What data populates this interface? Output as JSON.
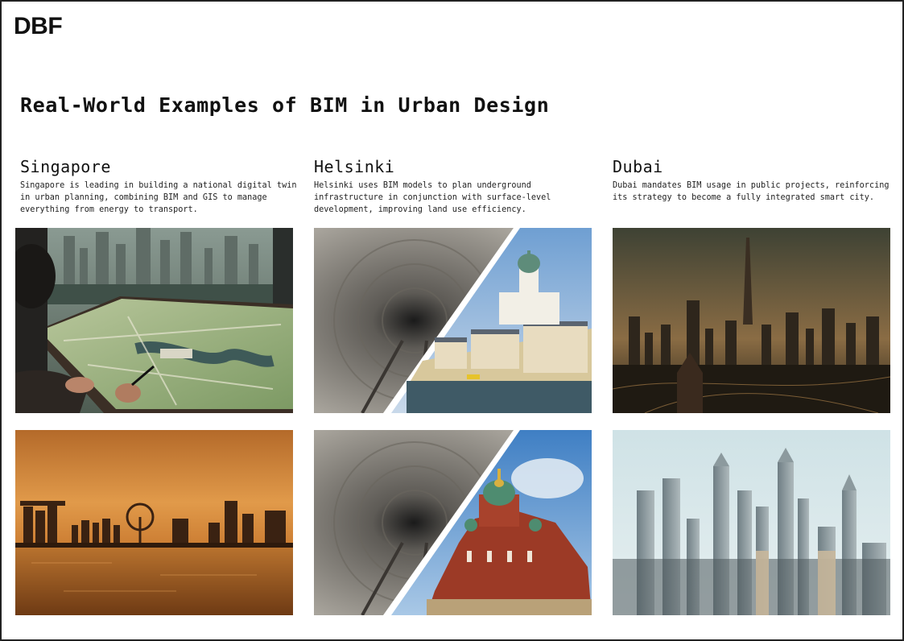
{
  "brand": {
    "logo_text": "DBF"
  },
  "page": {
    "title": "Real-World Examples of BIM in Urban Design"
  },
  "cities": [
    {
      "name": "Singapore",
      "description": "Singapore is leading in building a national digital twin in urban planning, combining BIM and GIS to manage everything from energy to transport.",
      "images": [
        "planner-with-3d-city-model-photo",
        "marina-bay-sunset-skyline-photo"
      ]
    },
    {
      "name": "Helsinki",
      "description": "Helsinki uses BIM models to plan underground infrastructure in conjunction with surface-level development, improving land use efficiency.",
      "images": [
        "tunnel-and-helsinki-cathedral-split-photo",
        "tunnel-and-uspenski-cathedral-split-photo"
      ]
    },
    {
      "name": "Dubai",
      "description": "Dubai mandates BIM usage in public projects, reinforcing its strategy to become a fully integrated smart city.",
      "images": [
        "dubai-dusk-skyline-photo",
        "dubai-skyscrapers-daytime-photo"
      ]
    }
  ]
}
